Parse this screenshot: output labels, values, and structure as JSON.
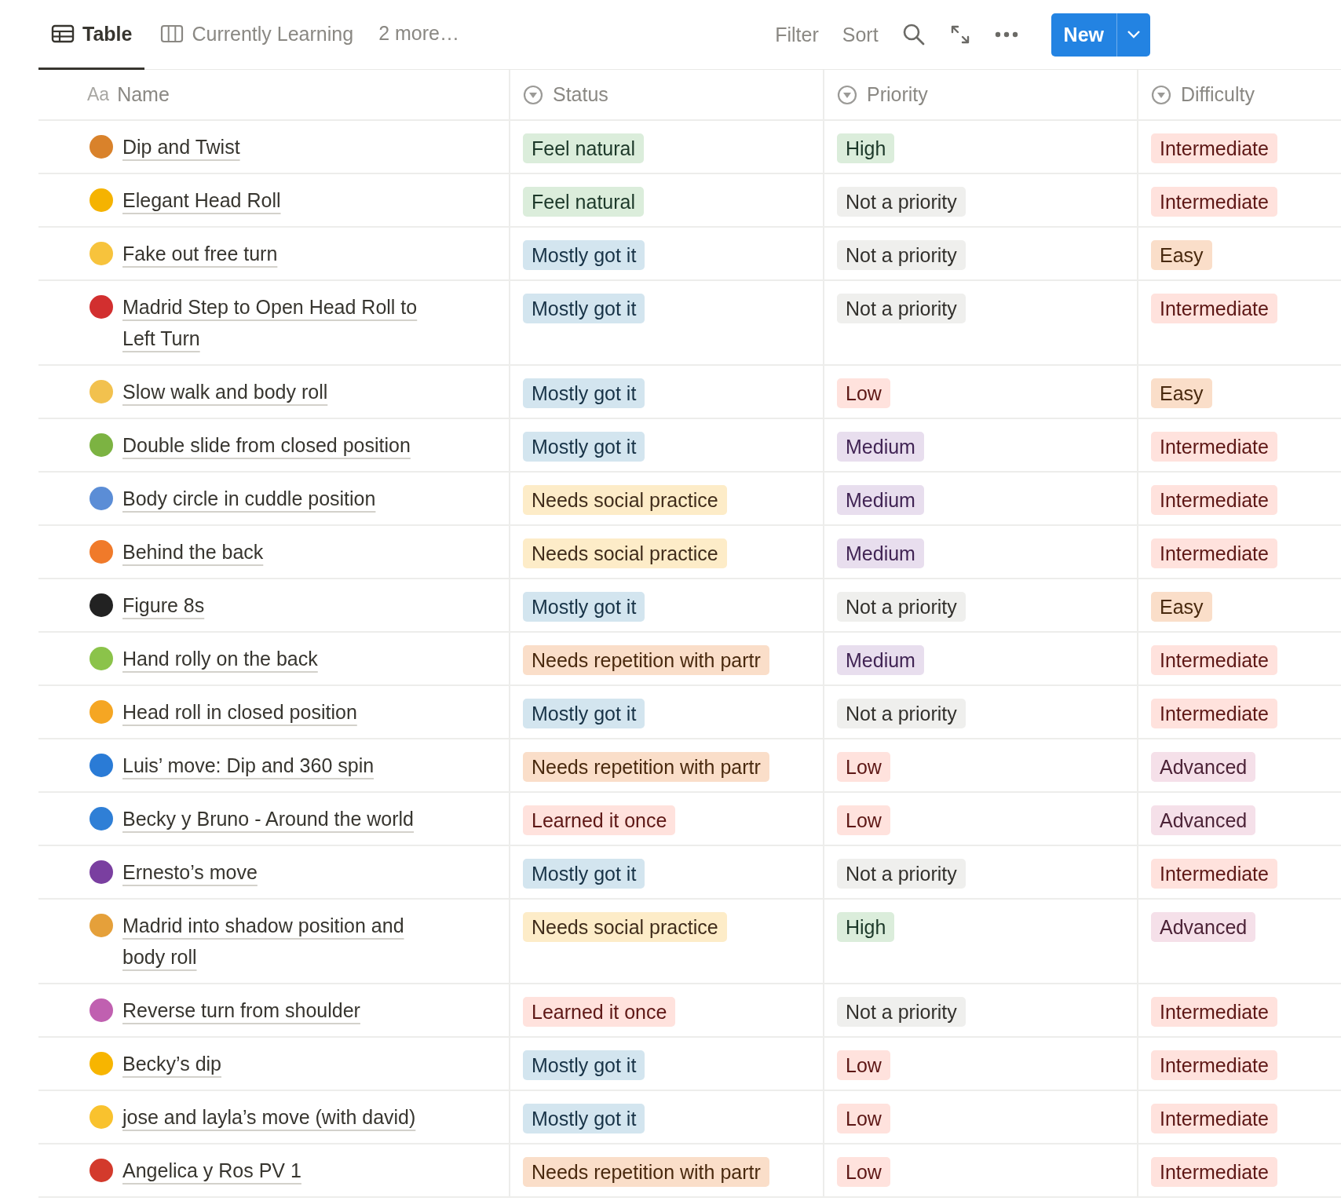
{
  "views": [
    {
      "label": "Table",
      "kind": "table",
      "selected": true
    },
    {
      "label": "Currently Learning",
      "kind": "board",
      "selected": false
    }
  ],
  "more_views": "2 more…",
  "toolbar": {
    "filter": "Filter",
    "sort": "Sort",
    "new_button": "New"
  },
  "columns": [
    {
      "label": "Name",
      "kind": "title",
      "type_icon": "Aa"
    },
    {
      "label": "Status",
      "kind": "select"
    },
    {
      "label": "Priority",
      "kind": "select"
    },
    {
      "label": "Difficulty",
      "kind": "select"
    }
  ],
  "rows": [
    {
      "name": "Dip and Twist",
      "color": "#d9822b",
      "status": {
        "label": "Feel natural",
        "color": "#dbeddb"
      },
      "priority": {
        "label": "High",
        "color": "#dbeddb"
      },
      "difficulty": {
        "label": "Intermediate",
        "color": "#ffe2dd"
      }
    },
    {
      "name": "Elegant Head Roll",
      "color": "#f5b301",
      "status": {
        "label": "Feel natural",
        "color": "#dbeddb"
      },
      "priority": {
        "label": "Not a priority",
        "color": "#efefed"
      },
      "difficulty": {
        "label": "Intermediate",
        "color": "#ffe2dd"
      }
    },
    {
      "name": "Fake out free turn",
      "color": "#f7c33c",
      "status": {
        "label": "Mostly got it",
        "color": "#d3e5ef"
      },
      "priority": {
        "label": "Not a priority",
        "color": "#efefed"
      },
      "difficulty": {
        "label": "Easy",
        "color": "#fadec9"
      }
    },
    {
      "name": "Madrid Step to Open Head Roll to Left Turn",
      "color": "#d22f2f",
      "status": {
        "label": "Mostly got it",
        "color": "#d3e5ef"
      },
      "priority": {
        "label": "Not a priority",
        "color": "#efefed"
      },
      "difficulty": {
        "label": "Intermediate",
        "color": "#ffe2dd"
      }
    },
    {
      "name": "Slow walk and body roll",
      "color": "#f2c14e",
      "status": {
        "label": "Mostly got it",
        "color": "#d3e5ef"
      },
      "priority": {
        "label": "Low",
        "color": "#ffe2dd"
      },
      "difficulty": {
        "label": "Easy",
        "color": "#fadec9"
      }
    },
    {
      "name": "Double slide from closed position",
      "color": "#7cb342",
      "status": {
        "label": "Mostly got it",
        "color": "#d3e5ef"
      },
      "priority": {
        "label": "Medium",
        "color": "#e8deee"
      },
      "difficulty": {
        "label": "Intermediate",
        "color": "#ffe2dd"
      }
    },
    {
      "name": "Body circle in cuddle position",
      "color": "#5b8dd6",
      "status": {
        "label": "Needs social practice",
        "color": "#fdecc8"
      },
      "priority": {
        "label": "Medium",
        "color": "#e8deee"
      },
      "difficulty": {
        "label": "Intermediate",
        "color": "#ffe2dd"
      }
    },
    {
      "name": "Behind the back",
      "color": "#f07a2a",
      "status": {
        "label": "Needs social practice",
        "color": "#fdecc8"
      },
      "priority": {
        "label": "Medium",
        "color": "#e8deee"
      },
      "difficulty": {
        "label": "Intermediate",
        "color": "#ffe2dd"
      }
    },
    {
      "name": "Figure 8s",
      "color": "#222222",
      "status": {
        "label": "Mostly got it",
        "color": "#d3e5ef"
      },
      "priority": {
        "label": "Not a priority",
        "color": "#efefed"
      },
      "difficulty": {
        "label": "Easy",
        "color": "#fadec9"
      }
    },
    {
      "name": "Hand rolly on the back",
      "color": "#8bc34a",
      "status": {
        "label": "Needs repetition with partr",
        "color": "#fadec9"
      },
      "priority": {
        "label": "Medium",
        "color": "#e8deee"
      },
      "difficulty": {
        "label": "Intermediate",
        "color": "#ffe2dd"
      }
    },
    {
      "name": "Head roll in closed position",
      "color": "#f5a623",
      "status": {
        "label": "Mostly got it",
        "color": "#d3e5ef"
      },
      "priority": {
        "label": "Not a priority",
        "color": "#efefed"
      },
      "difficulty": {
        "label": "Intermediate",
        "color": "#ffe2dd"
      }
    },
    {
      "name": "Luis’ move: Dip and 360 spin",
      "color": "#2a7bd6",
      "status": {
        "label": "Needs repetition with partr",
        "color": "#fadec9"
      },
      "priority": {
        "label": "Low",
        "color": "#ffe2dd"
      },
      "difficulty": {
        "label": "Advanced",
        "color": "#f5e0e9"
      }
    },
    {
      "name": "Becky y Bruno - Around the world",
      "color": "#2f7fd6",
      "status": {
        "label": "Learned it once",
        "color": "#ffe2dd"
      },
      "priority": {
        "label": "Low",
        "color": "#ffe2dd"
      },
      "difficulty": {
        "label": "Advanced",
        "color": "#f5e0e9"
      }
    },
    {
      "name": "Ernesto’s move",
      "color": "#7a3fa0",
      "status": {
        "label": "Mostly got it",
        "color": "#d3e5ef"
      },
      "priority": {
        "label": "Not a priority",
        "color": "#efefed"
      },
      "difficulty": {
        "label": "Intermediate",
        "color": "#ffe2dd"
      }
    },
    {
      "name": "Madrid into shadow position and body roll",
      "color": "#e5a03a",
      "status": {
        "label": "Needs social practice",
        "color": "#fdecc8"
      },
      "priority": {
        "label": "High",
        "color": "#dbeddb"
      },
      "difficulty": {
        "label": "Advanced",
        "color": "#f5e0e9"
      }
    },
    {
      "name": "Reverse turn from shoulder",
      "color": "#c060b0",
      "status": {
        "label": "Learned it once",
        "color": "#ffe2dd"
      },
      "priority": {
        "label": "Not a priority",
        "color": "#efefed"
      },
      "difficulty": {
        "label": "Intermediate",
        "color": "#ffe2dd"
      }
    },
    {
      "name": "Becky’s dip",
      "color": "#f7b500",
      "status": {
        "label": "Mostly got it",
        "color": "#d3e5ef"
      },
      "priority": {
        "label": "Low",
        "color": "#ffe2dd"
      },
      "difficulty": {
        "label": "Intermediate",
        "color": "#ffe2dd"
      }
    },
    {
      "name": "jose and layla’s move (with david)",
      "color": "#f9c22e",
      "status": {
        "label": "Mostly got it",
        "color": "#d3e5ef"
      },
      "priority": {
        "label": "Low",
        "color": "#ffe2dd"
      },
      "difficulty": {
        "label": "Intermediate",
        "color": "#ffe2dd"
      }
    },
    {
      "name": "Angelica y Ros PV 1",
      "color": "#d33a2c",
      "status": {
        "label": "Needs repetition with partr",
        "color": "#fadec9"
      },
      "priority": {
        "label": "Low",
        "color": "#ffe2dd"
      },
      "difficulty": {
        "label": "Intermediate",
        "color": "#ffe2dd"
      }
    }
  ]
}
